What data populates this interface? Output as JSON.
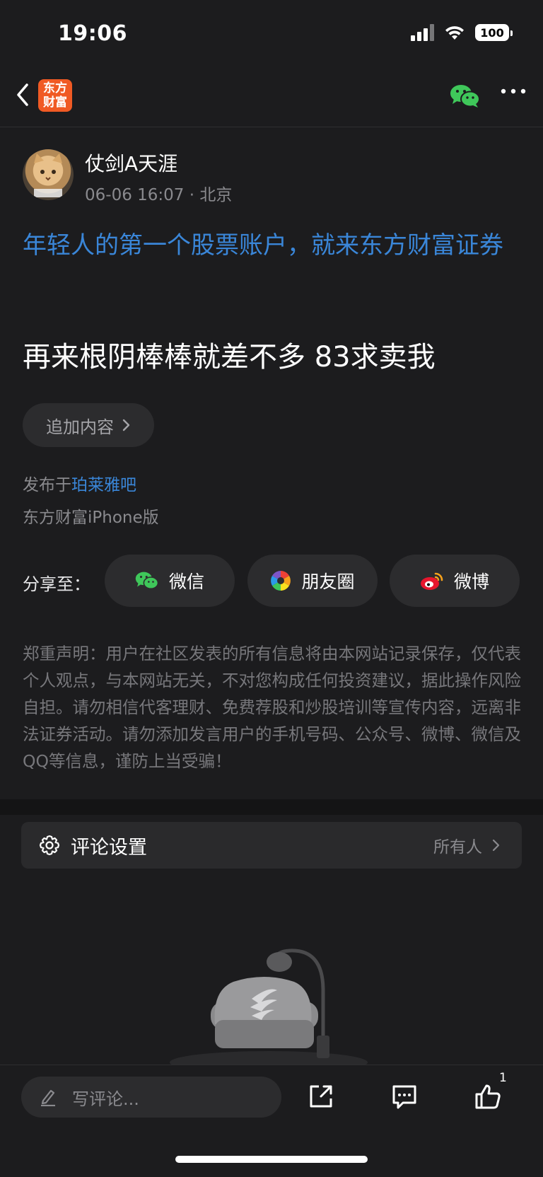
{
  "status": {
    "time": "19:06",
    "battery": "100"
  },
  "nav": {
    "logo_line1": "东方",
    "logo_line2": "财富"
  },
  "post": {
    "author": "仗剑A天涯",
    "date": "06-06 16:07",
    "location": "北京",
    "promo_line": "年轻人的第一个股票账户，就来东方财富证券",
    "content": "再来根阴棒棒就差不多 83求卖我",
    "add_content_label": "追加内容",
    "published_prefix": "发布于",
    "forum": "珀莱雅吧",
    "platform": "东方财富iPhone版"
  },
  "share": {
    "label": "分享至：",
    "items": [
      "微信",
      "朋友圈",
      "微博"
    ]
  },
  "disclaimer": "郑重声明：用户在社区发表的所有信息将由本网站记录保存，仅代表个人观点，与本网站无关，不对您构成任何投资建议，据此操作风险自担。请勿相信代客理财、免费荐股和炒股培训等宣传内容，远离非法证券活动。请勿添加发言用户的手机号码、公众号、微博、微信及QQ等信息，谨防上当受骗！",
  "comment_settings": {
    "label": "评论设置",
    "value": "所有人"
  },
  "bottom_bar": {
    "comment_placeholder": "写评论...",
    "like_count": "1"
  },
  "colors": {
    "background": "#1c1c1e",
    "accent_blue": "#3a86d8",
    "brand_orange": "#f05a24",
    "wechat_green": "#3fc75a"
  },
  "icons": [
    "back-chevron-icon",
    "wechat-icon",
    "more-icon",
    "chevron-right-icon",
    "moments-icon",
    "weibo-icon",
    "gear-icon",
    "pencil-icon",
    "share-out-icon",
    "comment-icon",
    "thumbs-up-icon"
  ]
}
